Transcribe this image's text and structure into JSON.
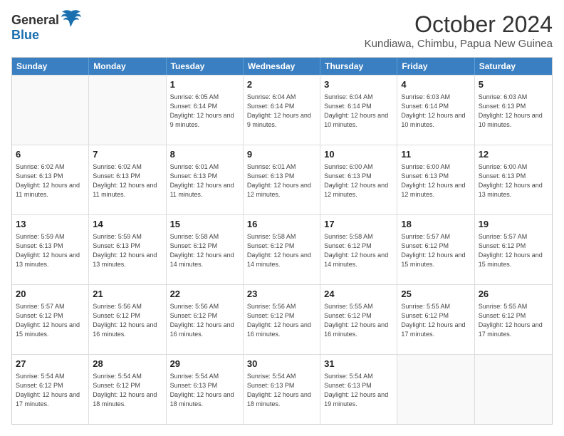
{
  "header": {
    "logo_general": "General",
    "logo_blue": "Blue",
    "month_title": "October 2024",
    "subtitle": "Kundiawa, Chimbu, Papua New Guinea"
  },
  "days_of_week": [
    "Sunday",
    "Monday",
    "Tuesday",
    "Wednesday",
    "Thursday",
    "Friday",
    "Saturday"
  ],
  "weeks": [
    [
      {
        "day": "",
        "info": ""
      },
      {
        "day": "",
        "info": ""
      },
      {
        "day": "1",
        "info": "Sunrise: 6:05 AM\nSunset: 6:14 PM\nDaylight: 12 hours and 9 minutes."
      },
      {
        "day": "2",
        "info": "Sunrise: 6:04 AM\nSunset: 6:14 PM\nDaylight: 12 hours and 9 minutes."
      },
      {
        "day": "3",
        "info": "Sunrise: 6:04 AM\nSunset: 6:14 PM\nDaylight: 12 hours and 10 minutes."
      },
      {
        "day": "4",
        "info": "Sunrise: 6:03 AM\nSunset: 6:14 PM\nDaylight: 12 hours and 10 minutes."
      },
      {
        "day": "5",
        "info": "Sunrise: 6:03 AM\nSunset: 6:13 PM\nDaylight: 12 hours and 10 minutes."
      }
    ],
    [
      {
        "day": "6",
        "info": "Sunrise: 6:02 AM\nSunset: 6:13 PM\nDaylight: 12 hours and 11 minutes."
      },
      {
        "day": "7",
        "info": "Sunrise: 6:02 AM\nSunset: 6:13 PM\nDaylight: 12 hours and 11 minutes."
      },
      {
        "day": "8",
        "info": "Sunrise: 6:01 AM\nSunset: 6:13 PM\nDaylight: 12 hours and 11 minutes."
      },
      {
        "day": "9",
        "info": "Sunrise: 6:01 AM\nSunset: 6:13 PM\nDaylight: 12 hours and 12 minutes."
      },
      {
        "day": "10",
        "info": "Sunrise: 6:00 AM\nSunset: 6:13 PM\nDaylight: 12 hours and 12 minutes."
      },
      {
        "day": "11",
        "info": "Sunrise: 6:00 AM\nSunset: 6:13 PM\nDaylight: 12 hours and 12 minutes."
      },
      {
        "day": "12",
        "info": "Sunrise: 6:00 AM\nSunset: 6:13 PM\nDaylight: 12 hours and 13 minutes."
      }
    ],
    [
      {
        "day": "13",
        "info": "Sunrise: 5:59 AM\nSunset: 6:13 PM\nDaylight: 12 hours and 13 minutes."
      },
      {
        "day": "14",
        "info": "Sunrise: 5:59 AM\nSunset: 6:13 PM\nDaylight: 12 hours and 13 minutes."
      },
      {
        "day": "15",
        "info": "Sunrise: 5:58 AM\nSunset: 6:12 PM\nDaylight: 12 hours and 14 minutes."
      },
      {
        "day": "16",
        "info": "Sunrise: 5:58 AM\nSunset: 6:12 PM\nDaylight: 12 hours and 14 minutes."
      },
      {
        "day": "17",
        "info": "Sunrise: 5:58 AM\nSunset: 6:12 PM\nDaylight: 12 hours and 14 minutes."
      },
      {
        "day": "18",
        "info": "Sunrise: 5:57 AM\nSunset: 6:12 PM\nDaylight: 12 hours and 15 minutes."
      },
      {
        "day": "19",
        "info": "Sunrise: 5:57 AM\nSunset: 6:12 PM\nDaylight: 12 hours and 15 minutes."
      }
    ],
    [
      {
        "day": "20",
        "info": "Sunrise: 5:57 AM\nSunset: 6:12 PM\nDaylight: 12 hours and 15 minutes."
      },
      {
        "day": "21",
        "info": "Sunrise: 5:56 AM\nSunset: 6:12 PM\nDaylight: 12 hours and 16 minutes."
      },
      {
        "day": "22",
        "info": "Sunrise: 5:56 AM\nSunset: 6:12 PM\nDaylight: 12 hours and 16 minutes."
      },
      {
        "day": "23",
        "info": "Sunrise: 5:56 AM\nSunset: 6:12 PM\nDaylight: 12 hours and 16 minutes."
      },
      {
        "day": "24",
        "info": "Sunrise: 5:55 AM\nSunset: 6:12 PM\nDaylight: 12 hours and 16 minutes."
      },
      {
        "day": "25",
        "info": "Sunrise: 5:55 AM\nSunset: 6:12 PM\nDaylight: 12 hours and 17 minutes."
      },
      {
        "day": "26",
        "info": "Sunrise: 5:55 AM\nSunset: 6:12 PM\nDaylight: 12 hours and 17 minutes."
      }
    ],
    [
      {
        "day": "27",
        "info": "Sunrise: 5:54 AM\nSunset: 6:12 PM\nDaylight: 12 hours and 17 minutes."
      },
      {
        "day": "28",
        "info": "Sunrise: 5:54 AM\nSunset: 6:12 PM\nDaylight: 12 hours and 18 minutes."
      },
      {
        "day": "29",
        "info": "Sunrise: 5:54 AM\nSunset: 6:13 PM\nDaylight: 12 hours and 18 minutes."
      },
      {
        "day": "30",
        "info": "Sunrise: 5:54 AM\nSunset: 6:13 PM\nDaylight: 12 hours and 18 minutes."
      },
      {
        "day": "31",
        "info": "Sunrise: 5:54 AM\nSunset: 6:13 PM\nDaylight: 12 hours and 19 minutes."
      },
      {
        "day": "",
        "info": ""
      },
      {
        "day": "",
        "info": ""
      }
    ]
  ]
}
